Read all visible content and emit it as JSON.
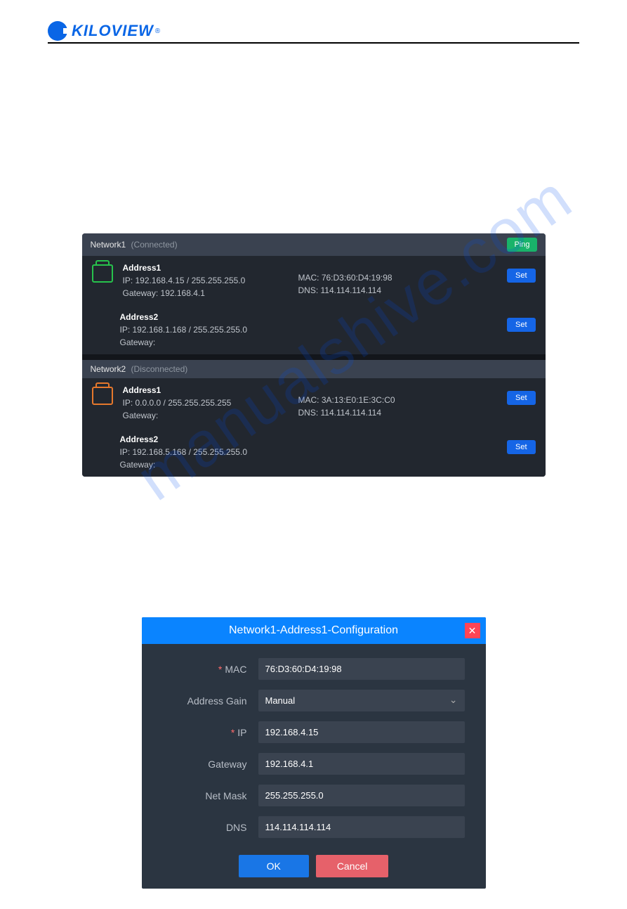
{
  "header": {
    "logo_text": "KILOVIEW",
    "trademark": "®"
  },
  "watermark": "manualshive.com",
  "network": {
    "sections": [
      {
        "name": "Network1",
        "status": "(Connected)",
        "ping_label": "Ping",
        "icon_color": "green",
        "addresses": [
          {
            "title": "Address1",
            "ip": "IP: 192.168.4.15 / 255.255.255.0",
            "gateway": "Gateway: 192.168.4.1",
            "mac": "MAC: 76:D3:60:D4:19:98",
            "dns": "DNS: 114.114.114.114",
            "set": "Set"
          },
          {
            "title": "Address2",
            "ip": "IP: 192.168.1.168 / 255.255.255.0",
            "gateway": "Gateway:",
            "mac": "",
            "dns": "",
            "set": "Set"
          }
        ]
      },
      {
        "name": "Network2",
        "status": "(Disconnected)",
        "ping_label": "",
        "icon_color": "orange",
        "addresses": [
          {
            "title": "Address1",
            "ip": "IP: 0.0.0.0 / 255.255.255.255",
            "gateway": "Gateway:",
            "mac": "MAC: 3A:13:E0:1E:3C:C0",
            "dns": "DNS: 114.114.114.114",
            "set": "Set"
          },
          {
            "title": "Address2",
            "ip": "IP: 192.168.5.168 / 255.255.255.0",
            "gateway": "Gateway:",
            "mac": "",
            "dns": "",
            "set": "Set"
          }
        ]
      }
    ]
  },
  "dialog": {
    "title": "Network1-Address1-Configuration",
    "fields": {
      "mac_label": "MAC",
      "mac_value": "76:D3:60:D4:19:98",
      "gain_label": "Address Gain",
      "gain_value": "Manual",
      "ip_label": "IP",
      "ip_value": "192.168.4.15",
      "gateway_label": "Gateway",
      "gateway_value": "192.168.4.1",
      "mask_label": "Net Mask",
      "mask_value": "255.255.255.0",
      "dns_label": "DNS",
      "dns_value": "114.114.114.114"
    },
    "ok": "OK",
    "cancel": "Cancel"
  }
}
